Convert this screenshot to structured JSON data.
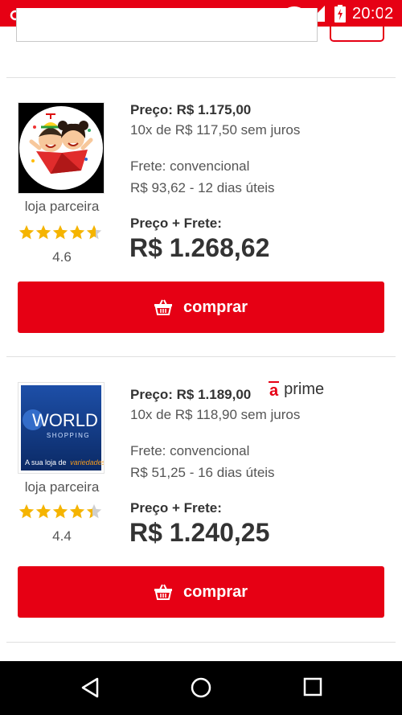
{
  "status_bar": {
    "time": "20:02"
  },
  "offers": [
    {
      "store_label": "loja parceira",
      "rating": "4.6",
      "stars_filled": 4.6,
      "price": "Preço: R$ 1.175,00",
      "installments": "10x de R$ 117,50 sem juros",
      "freight_key": "Frete:",
      "freight_type": "convencional",
      "freight_detail": "R$ 93,62 - 12 dias úteis",
      "total_label": "Preço + Frete:",
      "total_value": "R$ 1.268,62",
      "buy_label": "comprar"
    },
    {
      "store_label": "loja parceira",
      "rating": "4.4",
      "stars_filled": 4.4,
      "price": "Preço: R$ 1.189,00",
      "prime_icon_text": "a",
      "prime_label": "prime",
      "installments": "10x de R$ 118,90 sem juros",
      "freight_key": "Frete:",
      "freight_type": "convencional",
      "freight_detail": "R$ 51,25 - 16 dias úteis",
      "total_label": "Preço + Frete:",
      "total_value": "R$ 1.240,25",
      "buy_label": "comprar",
      "logo_text": {
        "title": "WORLD",
        "subtitle": "SHOPPING",
        "tagline_start": "A sua loja de",
        "tagline_end": "variedades"
      }
    }
  ],
  "colors": {
    "accent": "#e60014",
    "star": "#f5b400"
  },
  "icons": {
    "basket": "basket-icon",
    "back": "back-icon",
    "home": "home-icon",
    "recents": "recents-icon"
  }
}
